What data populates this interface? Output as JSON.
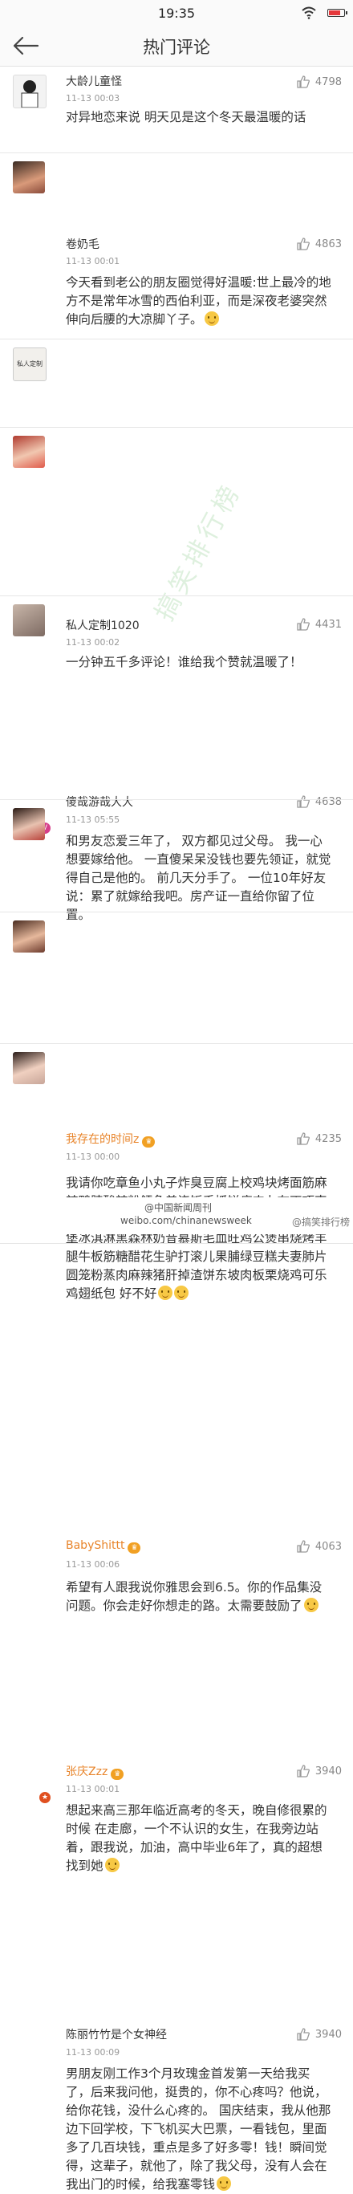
{
  "status_bar": {
    "time": "19:35"
  },
  "header": {
    "title": "热门评论"
  },
  "watermark": "搞笑排行榜",
  "comments": [
    {
      "name": "大龄儿童怪",
      "time": "11-13 00:03",
      "likes": "4798",
      "text": "对异地恋来说 明天见是这个冬天最温暖的话"
    },
    {
      "name": "卷奶毛",
      "time": "11-13 00:01",
      "likes": "4863",
      "text": "今天看到老公的朋友圈觉得好温暖:世上最冷的地方不是常年冰雪的西伯利亚，而是深夜老婆突然伸向后腰的大凉脚丫子。"
    },
    {
      "name": "私人定制1020",
      "time": "11-13 00:02",
      "likes": "4431",
      "avatar_text": "私人定制",
      "text": "一分钟五千多评论！谁给我个赞就温暖了！"
    },
    {
      "name": "傻哉游哉大大",
      "time": "11-13 05:55",
      "likes": "4638",
      "text": "和男友恋爱三年了， 双方都见过父母。 我一心想要嫁给他。 一直傻呆呆没钱也要先领证，就觉得自己是他的。 前几天分手了。 一位10年好友说：累了就嫁给我吧。房产证一直给你留了位置。"
    },
    {
      "name": "我存在的时间z",
      "time": "11-13 00:00",
      "likes": "4235",
      "text": "我请你吃章鱼小丸子炸臭豆腐上校鸡块烤面筋麻辣鸭脖酸辣粉鳕鱼盖浇饭手抓饼瘦肉丸布丁巧克力奶茶寿司森永水果糖不二家棒棒糖悠哈烤肉汉堡冰淇淋黑森林奶昔慕斯毛血旺鸡公煲串烧烤羊腿牛板筋糖醋花生驴打滚儿果脯绿豆糕夫妻肺片圆笼粉蒸肉麻辣猪肝掉渣饼东坡肉板栗烧鸡可乐鸡翅纸包 好不好"
    },
    {
      "name": "BabyShittt",
      "time": "11-13 00:06",
      "likes": "4063",
      "text": "希望有人跟我说你雅思会到6.5。你的作品集没问题。你会走好你想走的路。太需要鼓励了"
    },
    {
      "name": "张庆Zzz",
      "time": "11-13 00:01",
      "likes": "3940",
      "text": "想起来高三那年临近高考的冬天，晚自修很累的时候 在走廊，一个不认识的女生，在我旁边站着，跟我说，加油，高中毕业6年了，真的超想找到她"
    },
    {
      "name": "陈丽竹竹是个女神经",
      "time": "11-13 00:09",
      "likes": "3940",
      "text": "男朋友刚工作3个月玫瑰金首发第一天给我买了，后来我问他，挺贵的，你不心疼吗？他说，给你花钱，没什么心疼的。 国庆结束，我从他那边下回学校，下飞机买大巴票，一看钱包，里面多了几百块钱，重点是多了好多零！钱！瞬间觉得，这辈子，就他了，除了我父母，没有人会在我出门的时候，给我塞零钱"
    }
  ],
  "footer": {
    "weibo": "@中国新闻周刊",
    "url": "weibo.com/chinanewsweek",
    "watermark": "@搞笑排行榜"
  },
  "colors": {
    "orange_name": "#e8842a",
    "vip_badge": "#f1a023"
  }
}
